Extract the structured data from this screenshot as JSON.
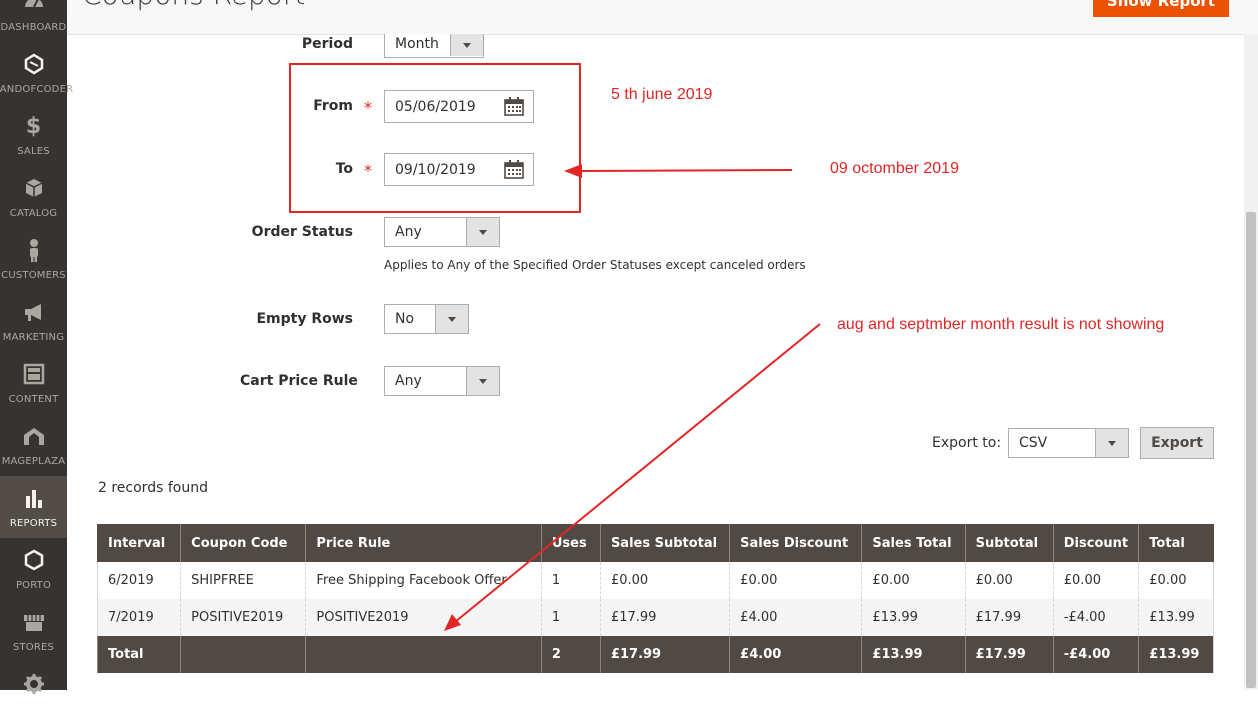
{
  "header": {
    "title": "Coupons Report",
    "show_report_label": "Show Report"
  },
  "sidebar": {
    "items": [
      {
        "label": "DASHBOARD",
        "icon": "dashboard-icon"
      },
      {
        "label": "LANDOFCODER",
        "icon": "landofcoder-icon"
      },
      {
        "label": "SALES",
        "icon": "dollar-icon"
      },
      {
        "label": "CATALOG",
        "icon": "box-icon"
      },
      {
        "label": "CUSTOMERS",
        "icon": "person-icon"
      },
      {
        "label": "MARKETING",
        "icon": "megaphone-icon"
      },
      {
        "label": "CONTENT",
        "icon": "layout-icon"
      },
      {
        "label": "MAGEPLAZA",
        "icon": "mageplaza-icon"
      },
      {
        "label": "REPORTS",
        "icon": "bar-chart-icon",
        "active": true
      },
      {
        "label": "PORTO",
        "icon": "hexagon-icon"
      },
      {
        "label": "STORES",
        "icon": "store-icon"
      },
      {
        "label": "",
        "icon": "gear-icon"
      }
    ]
  },
  "form": {
    "period": {
      "label": "Period",
      "value": "Month"
    },
    "from": {
      "label": "From",
      "required_mark": "*",
      "value": "05/06/2019"
    },
    "to": {
      "label": "To",
      "required_mark": "*",
      "value": "09/10/2019"
    },
    "order_status": {
      "label": "Order Status",
      "value": "Any",
      "note": "Applies to Any of the Specified Order Statuses except canceled orders"
    },
    "empty_rows": {
      "label": "Empty Rows",
      "value": "No"
    },
    "cart_price_rule": {
      "label": "Cart Price Rule",
      "value": "Any"
    }
  },
  "annotations": {
    "from_note": "5 th june 2019",
    "to_note": "09 octomber 2019",
    "result_note": "aug and septmber month result is not showing",
    "color": "#e22626"
  },
  "grid": {
    "records_found": "2 records found",
    "export_label": "Export to:",
    "export_format": "CSV",
    "export_button": "Export",
    "columns": [
      "Interval",
      "Coupon Code",
      "Price Rule",
      "Uses",
      "Sales Subtotal",
      "Sales Discount",
      "Sales Total",
      "Subtotal",
      "Discount",
      "Total"
    ],
    "rows": [
      [
        "6/2019",
        "SHIPFREE",
        "Free Shipping Facebook Offer",
        "1",
        "£0.00",
        "£0.00",
        "£0.00",
        "£0.00",
        "£0.00",
        "£0.00"
      ],
      [
        "7/2019",
        "POSITIVE2019",
        "POSITIVE2019",
        "1",
        "£17.99",
        "£4.00",
        "£13.99",
        "£17.99",
        "-£4.00",
        "£13.99"
      ]
    ],
    "totals": [
      "Total",
      "",
      "",
      "2",
      "£17.99",
      "£4.00",
      "£13.99",
      "£17.99",
      "-£4.00",
      "£13.99"
    ]
  },
  "colors": {
    "accent": "#eb5202",
    "sidebar": "#373330",
    "table_header": "#514943"
  }
}
